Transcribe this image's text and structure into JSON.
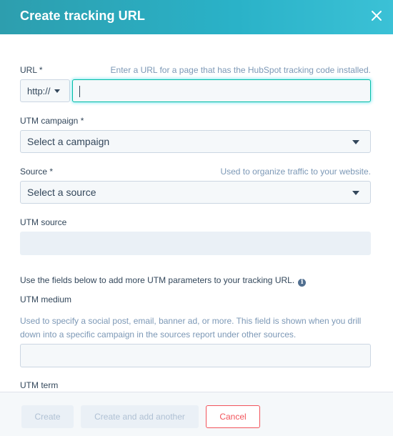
{
  "modal": {
    "title": "Create tracking URL",
    "close_icon": "close-icon"
  },
  "url": {
    "label": "URL *",
    "hint": "Enter a URL for a page that has the HubSpot tracking code installed.",
    "protocol": "http://",
    "value": ""
  },
  "utm_campaign": {
    "label": "UTM campaign *",
    "selected": "Select a campaign"
  },
  "source": {
    "label": "Source *",
    "hint": "Used to organize traffic to your website.",
    "selected": "Select a source"
  },
  "utm_source": {
    "label": "UTM source",
    "value": ""
  },
  "more_params": {
    "text": "Use the fields below to add more UTM parameters to your tracking URL.",
    "icon": "info-icon"
  },
  "utm_medium": {
    "label": "UTM medium",
    "help": "Used to specify a social post, email, banner ad, or more. This field is shown when you drill down into a specific campaign in the sources report under other sources.",
    "value": ""
  },
  "utm_term": {
    "label": "UTM term"
  },
  "footer": {
    "create_label": "Create",
    "create_add_label": "Create and add another",
    "cancel_label": "Cancel"
  },
  "colors": {
    "header_accent": "#2ab2c8",
    "focus": "#00bda5",
    "cancel": "#f2545b",
    "text": "#33475b",
    "hint": "#7c98b6"
  }
}
